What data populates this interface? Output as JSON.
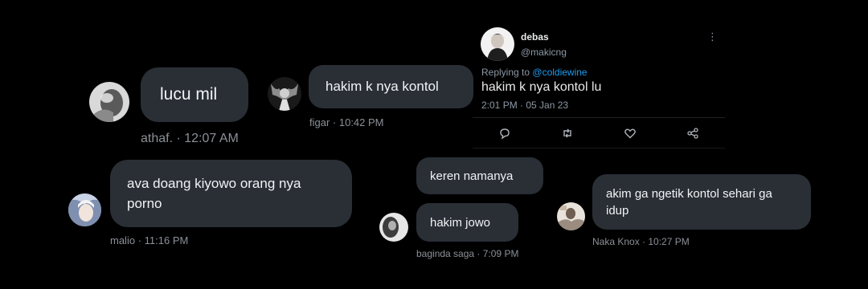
{
  "messages": [
    {
      "text": "lucu mil",
      "author": "athaf.",
      "time": "12:07 AM"
    },
    {
      "text": "hakim k nya kontol",
      "author": "figar",
      "time": "10:42 PM"
    },
    {
      "text": "ava doang kiyowo orang nya porno",
      "author": "malio",
      "time": "11:16 PM"
    },
    {
      "text": "keren namanya",
      "text2": "hakim jowo",
      "author": "baginda saga",
      "time": "7:09 PM"
    },
    {
      "text": "akim ga ngetik kontol sehari ga idup",
      "author": "Naka Knox",
      "time": "10:27 PM"
    }
  ],
  "tweet": {
    "name": "debas",
    "handle": "@makicng",
    "more_icon": "more-horizontal-icon",
    "reply_prefix": "Replying to",
    "reply_to": "@coldiewine",
    "text": "hakim k nya kontol lu",
    "timestamp": "2:01 PM · 05 Jan 23",
    "actions": [
      "reply-icon",
      "retweet-icon",
      "like-icon",
      "share-icon"
    ]
  },
  "colors": {
    "background": "#000000",
    "bubble": "#2a2f36",
    "bubble_text": "#f1f3f5",
    "meta_text": "#8b9096",
    "link": "#1d9bf0"
  }
}
